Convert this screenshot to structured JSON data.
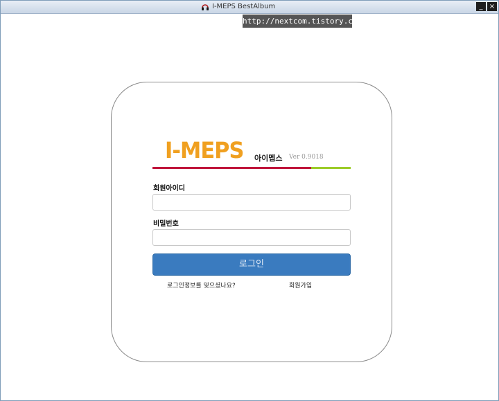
{
  "window": {
    "title": "I-MEPS BestAlbum",
    "minimize_label": "_",
    "close_label": "×"
  },
  "overlay": {
    "url": "http://nextcom.tistory.com"
  },
  "logo": {
    "brand": "I-MEPS",
    "korean": "아이멥스",
    "version": "Ver 0.9018"
  },
  "form": {
    "id_label": "회원아이디",
    "id_value": "",
    "id_placeholder": "",
    "password_label": "비밀번호",
    "password_value": "",
    "login_button": "로그인",
    "forgot_link": "로그인정보를 잊으셨나요?",
    "join_link": "회원가입"
  },
  "colors": {
    "brand_orange": "#f0a020",
    "bar_red": "#c0163c",
    "bar_green": "#9ccc2a",
    "button_blue": "#3a7bbf"
  },
  "icons": {
    "app": "headphones-icon"
  }
}
